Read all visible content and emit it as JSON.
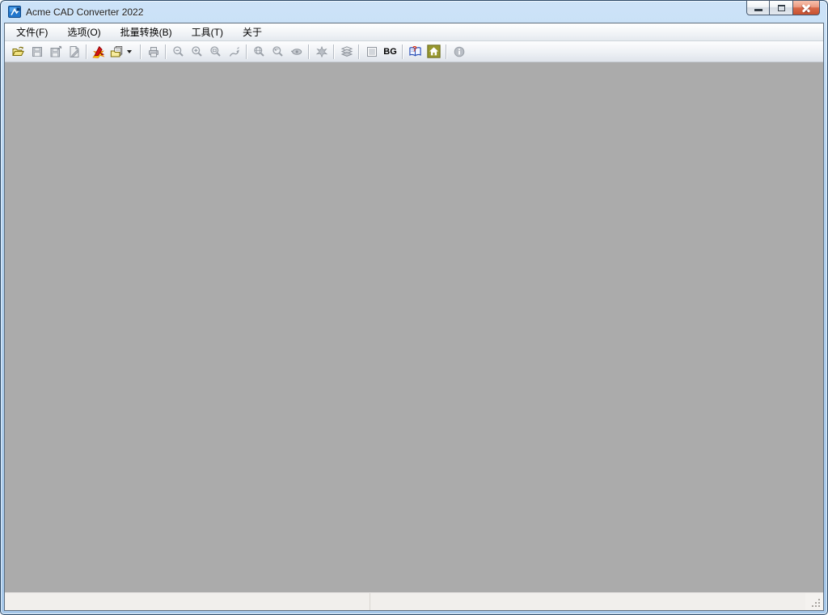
{
  "window": {
    "title": "Acme CAD Converter 2022",
    "controls": [
      {
        "name": "minimize"
      },
      {
        "name": "maximize"
      },
      {
        "name": "close"
      }
    ]
  },
  "menu": {
    "items": [
      {
        "label": "文件(F)"
      },
      {
        "label": "选项(O)"
      },
      {
        "label": "批量转换(B)"
      },
      {
        "label": "工具(T)"
      },
      {
        "label": "关于"
      }
    ]
  },
  "toolbar": {
    "icons": [
      {
        "name": "open-icon",
        "enabled": true
      },
      {
        "name": "save-icon",
        "enabled": false
      },
      {
        "name": "save-as-icon",
        "enabled": false
      },
      {
        "name": "export-icon",
        "enabled": false
      },
      {
        "name": "batch-convert-icon",
        "enabled": true
      },
      {
        "name": "convert-format-icon",
        "enabled": true,
        "has_dropdown": true
      },
      {
        "name": "print-icon",
        "enabled": false
      },
      {
        "name": "zoom-out-icon",
        "enabled": false
      },
      {
        "name": "zoom-in-icon",
        "enabled": false
      },
      {
        "name": "zoom-window-icon",
        "enabled": false
      },
      {
        "name": "zoom-dynamic-icon",
        "enabled": false
      },
      {
        "name": "zoom-all-icon",
        "enabled": false
      },
      {
        "name": "zoom-previous-icon",
        "enabled": false
      },
      {
        "name": "view-eye-icon",
        "enabled": false
      },
      {
        "name": "plot-splat-icon",
        "enabled": false
      },
      {
        "name": "layers-icon",
        "enabled": false
      },
      {
        "name": "background-pattern-icon",
        "enabled": true
      },
      {
        "name": "background-color-button",
        "enabled": true,
        "label": "BG"
      },
      {
        "name": "help-book-icon",
        "enabled": true
      },
      {
        "name": "home-icon",
        "enabled": true
      },
      {
        "name": "about-info-icon",
        "enabled": false
      }
    ]
  },
  "statusbar": {
    "left_text": "",
    "right_text": ""
  },
  "colors": {
    "titlebar_blue": "#b4d3f0",
    "client_gray": "#ababab",
    "close_button_red": "#d96a4a",
    "home_icon_olive": "#97972e",
    "statusbar_gray": "#f1efec"
  }
}
